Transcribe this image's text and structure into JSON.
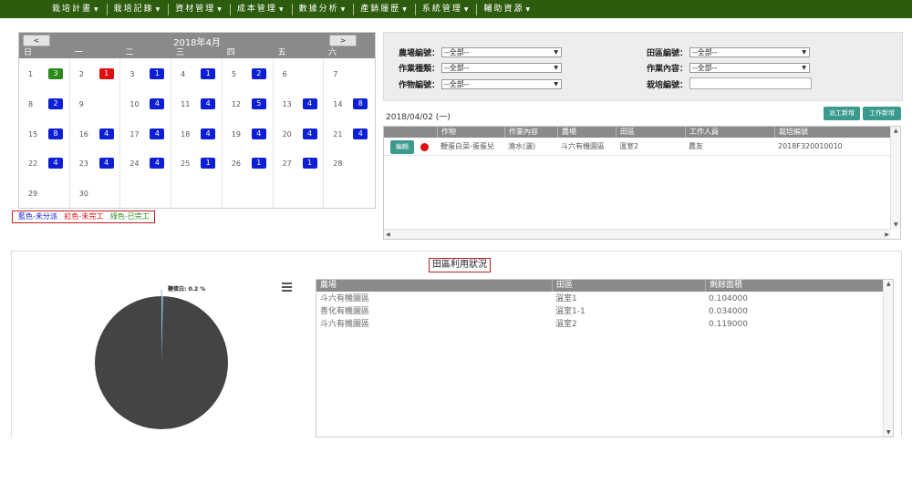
{
  "nav": [
    {
      "label": "栽培計畫"
    },
    {
      "label": "栽培記錄"
    },
    {
      "label": "資材管理"
    },
    {
      "label": "成本管理"
    },
    {
      "label": "數據分析"
    },
    {
      "label": "產銷履歷"
    },
    {
      "label": "系統管理"
    },
    {
      "label": "輔助資源"
    }
  ],
  "calendar": {
    "prev_label": "<",
    "next_label": ">",
    "title": "2018年4月",
    "weekdays": [
      "日",
      "一",
      "二",
      "三",
      "四",
      "五",
      "六"
    ],
    "days": [
      {
        "day": "1",
        "count": "3",
        "status": "green"
      },
      {
        "day": "2",
        "count": "1",
        "status": "red"
      },
      {
        "day": "3",
        "count": "1",
        "status": "blue"
      },
      {
        "day": "4",
        "count": "1",
        "status": "blue"
      },
      {
        "day": "5",
        "count": "2",
        "status": "blue"
      },
      {
        "day": "6",
        "count": "",
        "status": ""
      },
      {
        "day": "7",
        "count": "",
        "status": ""
      },
      {
        "day": "8",
        "count": "2",
        "status": "blue"
      },
      {
        "day": "9",
        "count": "",
        "status": ""
      },
      {
        "day": "10",
        "count": "4",
        "status": "blue"
      },
      {
        "day": "11",
        "count": "4",
        "status": "blue"
      },
      {
        "day": "12",
        "count": "5",
        "status": "blue"
      },
      {
        "day": "13",
        "count": "4",
        "status": "blue"
      },
      {
        "day": "14",
        "count": "8",
        "status": "blue"
      },
      {
        "day": "15",
        "count": "8",
        "status": "blue"
      },
      {
        "day": "16",
        "count": "4",
        "status": "blue"
      },
      {
        "day": "17",
        "count": "4",
        "status": "blue"
      },
      {
        "day": "18",
        "count": "4",
        "status": "blue"
      },
      {
        "day": "19",
        "count": "4",
        "status": "blue"
      },
      {
        "day": "20",
        "count": "4",
        "status": "blue"
      },
      {
        "day": "21",
        "count": "4",
        "status": "blue"
      },
      {
        "day": "22",
        "count": "4",
        "status": "blue"
      },
      {
        "day": "23",
        "count": "4",
        "status": "blue"
      },
      {
        "day": "24",
        "count": "4",
        "status": "blue"
      },
      {
        "day": "25",
        "count": "1",
        "status": "blue"
      },
      {
        "day": "26",
        "count": "1",
        "status": "blue"
      },
      {
        "day": "27",
        "count": "1",
        "status": "blue"
      },
      {
        "day": "28",
        "count": "",
        "status": ""
      },
      {
        "day": "29",
        "count": "",
        "status": ""
      },
      {
        "day": "30",
        "count": "",
        "status": ""
      }
    ],
    "legend": {
      "blue": "藍色-未分派",
      "red": "紅色-未完工",
      "green": "綠色-已完工"
    }
  },
  "colors": {
    "blue": "#0d1fd6",
    "red": "#e00d0d",
    "green": "#2b8a1c",
    "nav_bg": "#2e5c0e",
    "accent": "#3a9a8e"
  },
  "filter": {
    "farm_label": "農場編號：",
    "farm_value": "--全部--",
    "work_type_label": "作業種類：",
    "work_type_value": "--全部--",
    "crop_label": "作物編號：",
    "crop_value": "--全部--",
    "field_label": "田區編號：",
    "field_value": "--全部--",
    "work_content_label": "作業內容：",
    "work_content_value": "--全部--",
    "cultivation_label": "栽培編號：",
    "cultivation_value": ""
  },
  "work_panel": {
    "date": "2018/04/02 (一)",
    "dispatch_label": "派工新增",
    "add_work_label": "工作新增",
    "columns": [
      "作物",
      "作業內容",
      "農場",
      "田區",
      "工作人員",
      "栽培編號"
    ],
    "rows": [
      {
        "edit_label": "編輯",
        "crop": "鞭蛋白菜-蛋蛋兒",
        "content": "澆水(灑)",
        "farm": "斗六有機園區",
        "field": "溫室2",
        "worker": "農友",
        "cultivation_no": "2018F320010010"
      }
    ]
  },
  "usage": {
    "title": "田區利用狀況",
    "pie_label": "鞭蛋白: 0.2 %",
    "columns": [
      "農場",
      "田區",
      "剩餘面積"
    ],
    "rows": [
      {
        "farm": "斗六有機園區",
        "field": "溫室1",
        "area": "0.104000"
      },
      {
        "farm": "善化有機園區",
        "field": "溫室1-1",
        "area": "0.034000"
      },
      {
        "farm": "斗六有機園區",
        "field": "溫室2",
        "area": "0.119000"
      }
    ]
  },
  "chart_data": {
    "type": "pie",
    "slices": [
      {
        "label": "鞭蛋白",
        "value": 0.2
      }
    ]
  }
}
